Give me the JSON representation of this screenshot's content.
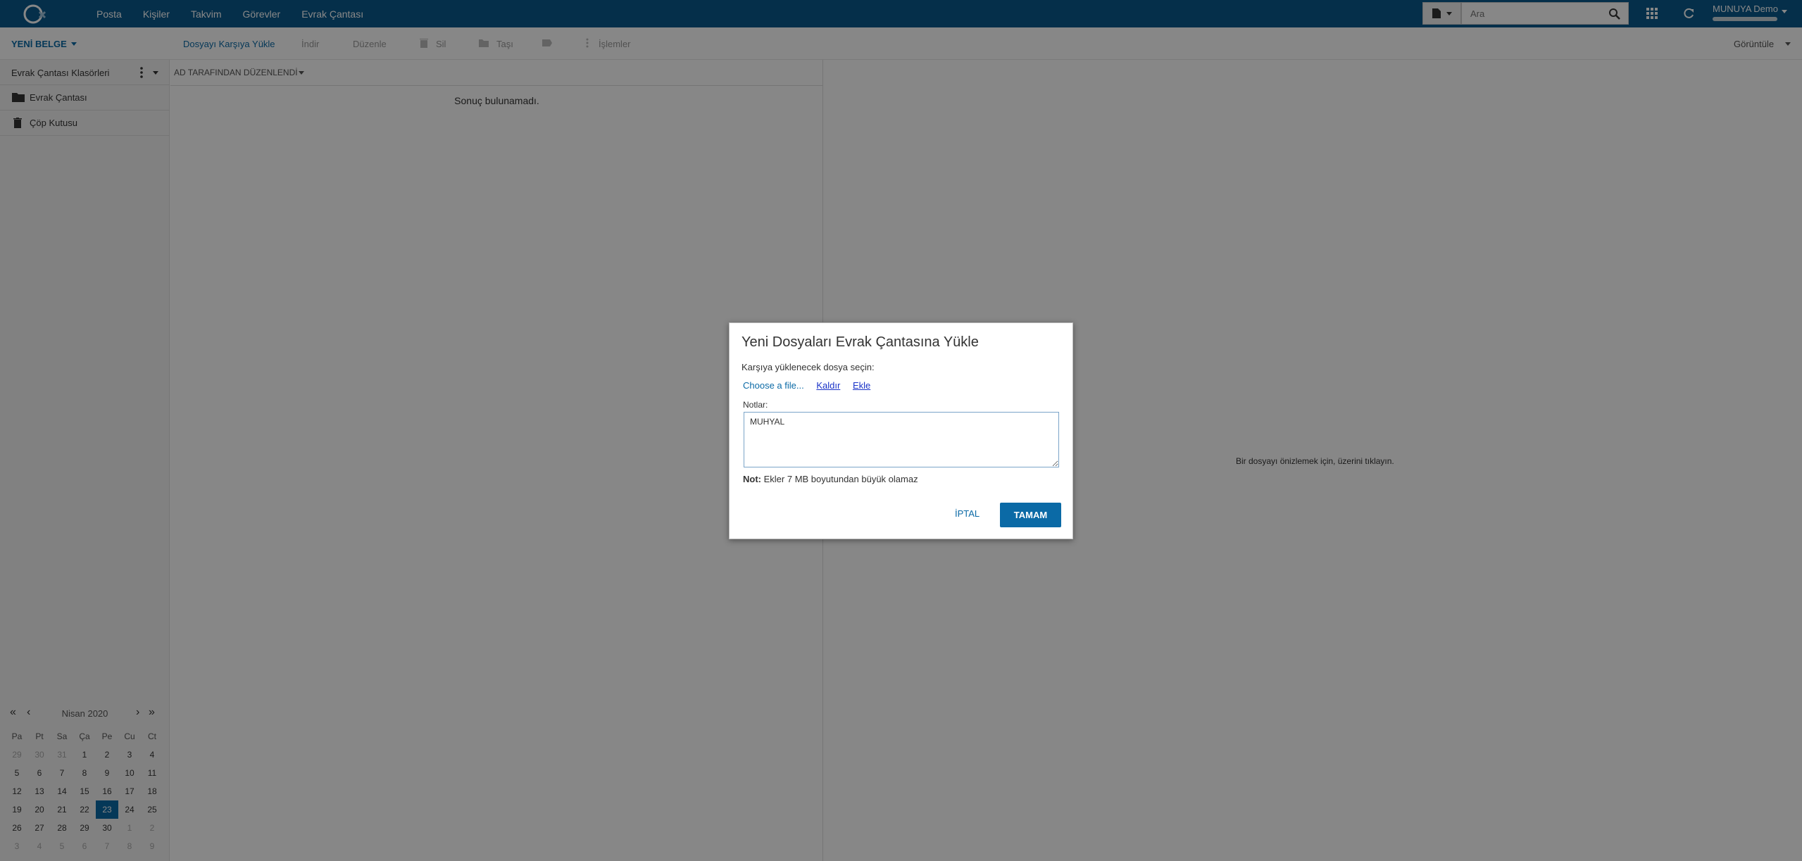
{
  "header": {
    "nav": [
      "Posta",
      "Kişiler",
      "Takvim",
      "Görevler",
      "Evrak Çantası"
    ],
    "search_placeholder": "Ara",
    "user_name": "MUNUYA Demo"
  },
  "toolbar": {
    "new_doc": "YENİ BELGE",
    "upload": "Dosyayı Karşıya Yükle",
    "download": "İndir",
    "edit": "Düzenle",
    "delete": "Sil",
    "move": "Taşı",
    "actions": "İşlemler",
    "view": "Görüntüle"
  },
  "sidebar": {
    "title": "Evrak Çantası Klasörleri",
    "folders": [
      {
        "label": "Evrak Çantası",
        "icon": "folder-icon"
      },
      {
        "label": "Çöp Kutusu",
        "icon": "trash-icon"
      }
    ]
  },
  "calendar": {
    "month": "Nisan 2020",
    "weekdays": [
      "Pa",
      "Pt",
      "Sa",
      "Ça",
      "Pe",
      "Cu",
      "Ct"
    ],
    "weeks": [
      [
        "29",
        "30",
        "31",
        "1",
        "2",
        "3",
        "4"
      ],
      [
        "5",
        "6",
        "7",
        "8",
        "9",
        "10",
        "11"
      ],
      [
        "12",
        "13",
        "14",
        "15",
        "16",
        "17",
        "18"
      ],
      [
        "19",
        "20",
        "21",
        "22",
        "23",
        "24",
        "25"
      ],
      [
        "26",
        "27",
        "28",
        "29",
        "30",
        "1",
        "2"
      ],
      [
        "3",
        "4",
        "5",
        "6",
        "7",
        "8",
        "9"
      ]
    ],
    "selected_day": "23"
  },
  "list": {
    "sort_label": "AD TARAFINDAN DÜZENLENDİ",
    "empty_text": "Sonuç bulunamadı."
  },
  "preview": {
    "hint": "Bir dosyayı önizlemek için, üzerini tıklayın."
  },
  "dialog": {
    "title": "Yeni Dosyaları Evrak Çantasına Yükle",
    "choose_label": "Karşıya yüklenecek dosya seçin:",
    "choose_link": "Choose a file...",
    "remove_link": "Kaldır",
    "add_link": "Ekle",
    "notes_label": "Notlar:",
    "notes_value": "MUHYAL",
    "note_prefix": "Not:",
    "note_text": "Ekler 7 MB boyutundan büyük olamaz",
    "cancel": "İPTAL",
    "ok": "TAMAM"
  },
  "colors": {
    "header_bg": "#0b5a8c",
    "accent": "#0b6aa6"
  }
}
